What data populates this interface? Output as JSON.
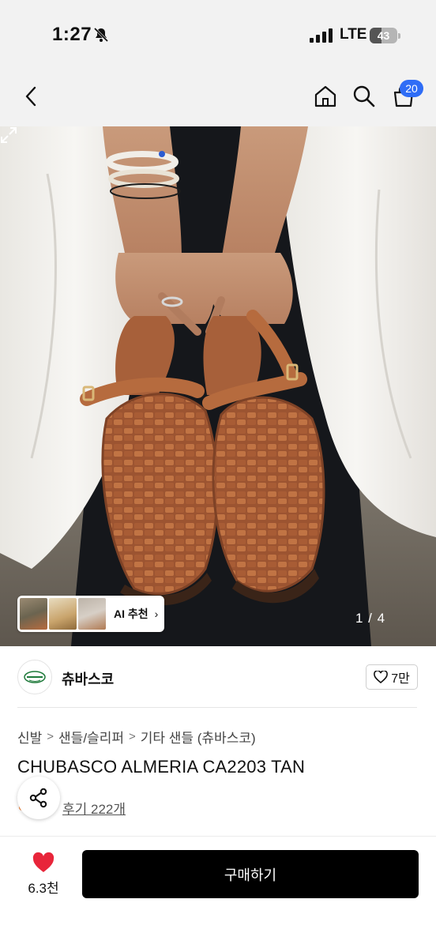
{
  "status_bar": {
    "time": "1:27",
    "network": "LTE",
    "battery": 43,
    "battery_label": "43"
  },
  "nav": {
    "cart_count": "20",
    "icons": [
      "back-chevron-icon",
      "home-icon",
      "search-icon",
      "cart-bag-icon"
    ]
  },
  "gallery": {
    "page_indicator": "1 / 4",
    "ai_recommend_label": "AI 추천",
    "ai_chevron": "›"
  },
  "brand": {
    "name": "츄바스코",
    "likes": "7만"
  },
  "product": {
    "breadcrumb": [
      "신발",
      "샌들/슬리퍼",
      "기타 샌들 (츄바스코)"
    ],
    "breadcrumb_separator": ">",
    "title": "CHUBASCO ALMERIA CA2203 TAN",
    "review_link": "후기 222개"
  },
  "bottom_bar": {
    "wish_count": "6.3천",
    "buy_label": "구매하기"
  },
  "colors": {
    "accent_blue": "#2f6df6",
    "heart_red": "#e8253a",
    "buy_button": "#000000",
    "sandal_tan": "#b2643a"
  }
}
